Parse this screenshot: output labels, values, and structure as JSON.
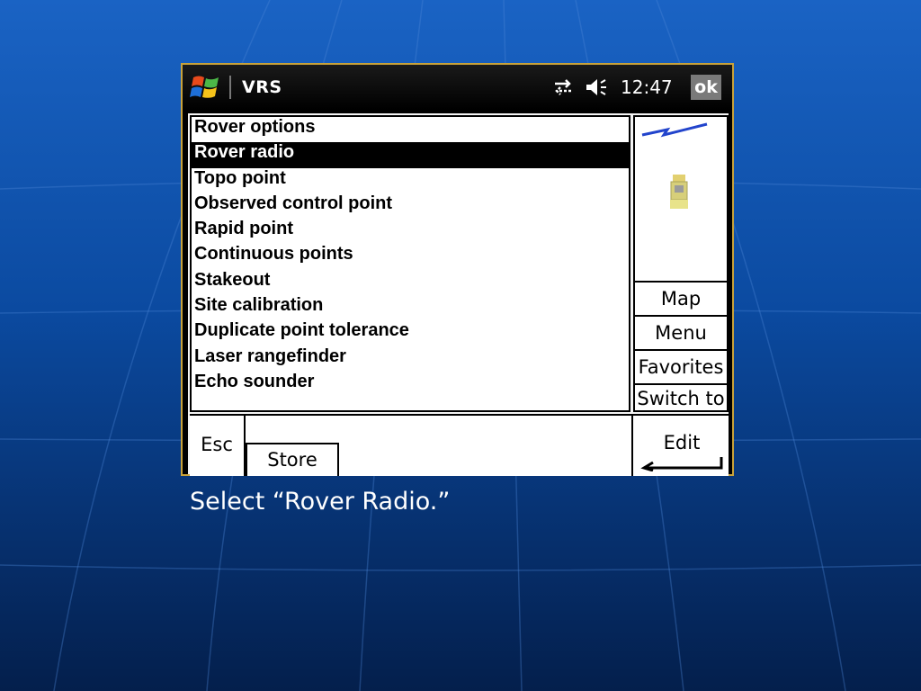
{
  "window": {
    "title": "VRS",
    "clock": "12:47",
    "ok_label": "ok"
  },
  "list": {
    "items": [
      {
        "label": "Rover options",
        "selected": false
      },
      {
        "label": "Rover radio",
        "selected": true
      },
      {
        "label": "Topo point",
        "selected": false
      },
      {
        "label": "Observed control point",
        "selected": false
      },
      {
        "label": "Rapid point",
        "selected": false
      },
      {
        "label": "Continuous points",
        "selected": false
      },
      {
        "label": "Stakeout",
        "selected": false
      },
      {
        "label": "Site calibration",
        "selected": false
      },
      {
        "label": "Duplicate point tolerance",
        "selected": false
      },
      {
        "label": "Laser rangefinder",
        "selected": false
      },
      {
        "label": "Echo sounder",
        "selected": false
      }
    ]
  },
  "side_buttons": {
    "map": "Map",
    "menu": "Menu",
    "favorites": "Favorites",
    "switch_to": "Switch to"
  },
  "bottom": {
    "esc_label": "Esc",
    "store_label": "Store",
    "edit_label": "Edit"
  },
  "caption": "Select “Rover Radio.”",
  "icons": [
    "windows-logo-icon",
    "connection-icon",
    "volume-icon",
    "radio-signal-icon",
    "instrument-icon",
    "enter-icon"
  ],
  "colors": {
    "background": "#0b4aa0",
    "device_border": "#c9a23a",
    "selection": "#000000"
  }
}
